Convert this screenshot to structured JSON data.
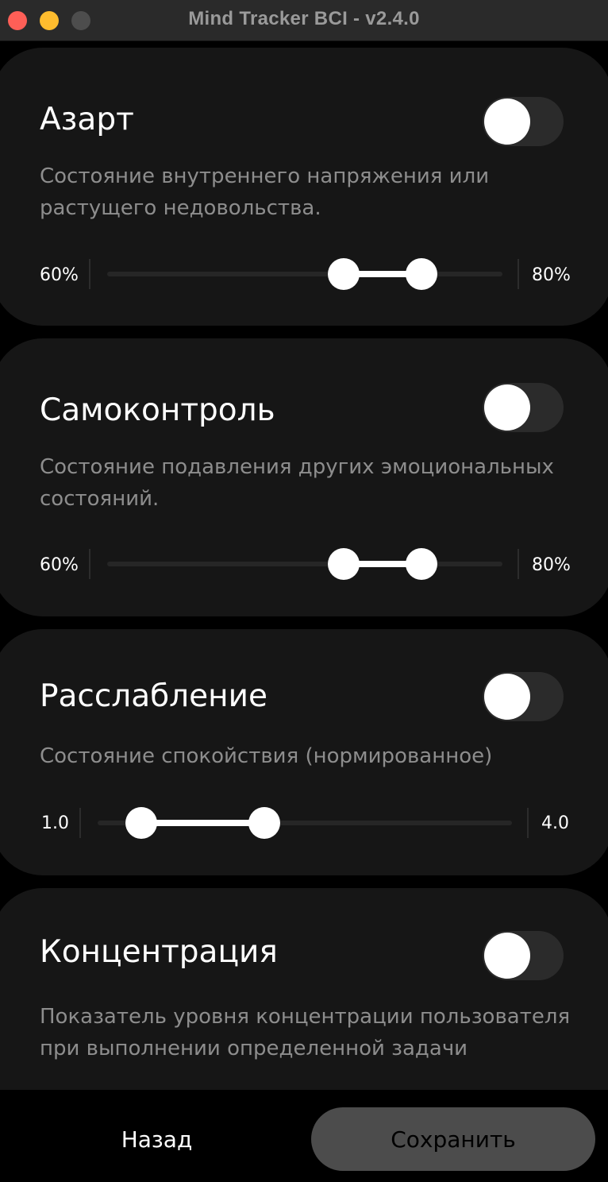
{
  "window": {
    "title": "Mind Tracker BCI - v2.4.0"
  },
  "cards": [
    {
      "title": "Азарт",
      "description": "Состояние внутреннего напряжения или растущего недовольства.",
      "toggle_on": false,
      "range": {
        "min_label": "60%",
        "max_label": "80%",
        "low": 0.6,
        "high": 0.8
      }
    },
    {
      "title": "Самоконтроль",
      "description": "Состояние подавления других эмоциональных состояний.",
      "toggle_on": false,
      "range": {
        "min_label": "60%",
        "max_label": "80%",
        "low": 0.6,
        "high": 0.8
      }
    },
    {
      "title": "Расслабление",
      "description": "Состояние спокойствия (нормированное)",
      "toggle_on": false,
      "range": {
        "min_label": "1.0",
        "max_label": "4.0",
        "low": 1.0,
        "high": 4.0
      }
    },
    {
      "title": "Концентрация",
      "description": "Показатель уровня концентрации пользователя при выполнении определенной задачи",
      "toggle_on": false
    }
  ],
  "footer": {
    "back_label": "Назад",
    "save_label": "Сохранить"
  },
  "colors": {
    "background": "#000000",
    "card": "#161616",
    "toggle_track": "#2b2b2b",
    "save_button": "#4c4c4c",
    "description_text": "#8d8d8d"
  }
}
